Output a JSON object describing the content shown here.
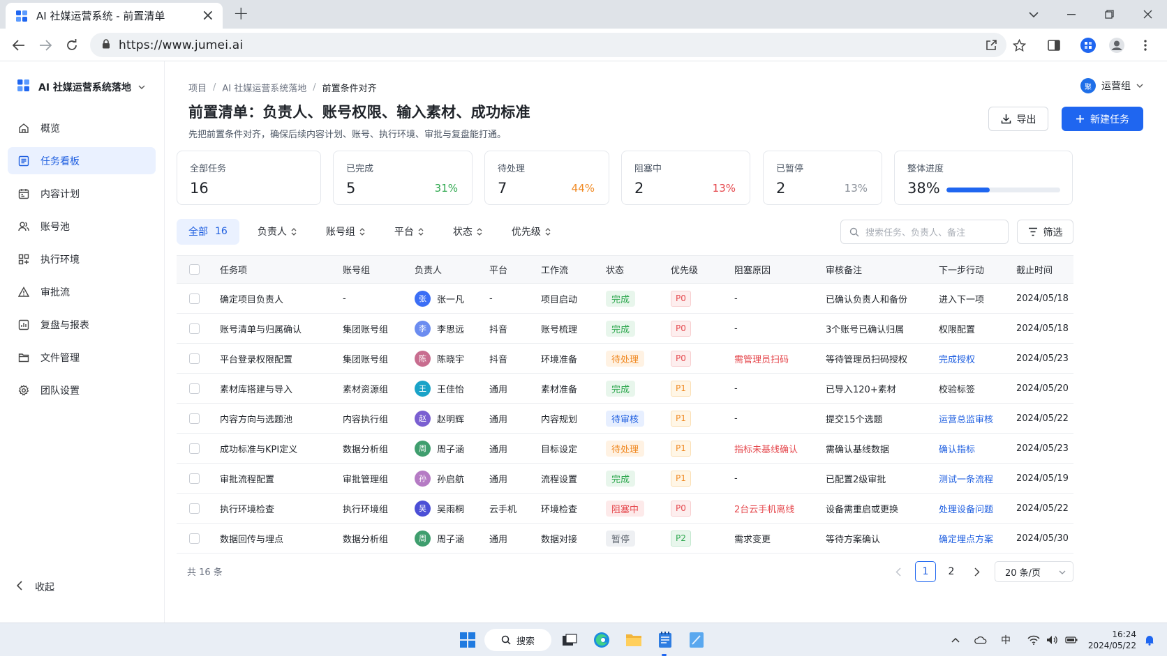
{
  "browser": {
    "tab_title": "AI 社媒运营系统 - 前置清单",
    "url": "https://www.jumei.ai"
  },
  "sidebar": {
    "brand": "AI 社媒运营系统落地",
    "items": [
      {
        "label": "概览",
        "icon": "home-icon"
      },
      {
        "label": "任务看板",
        "icon": "board-icon",
        "active": true
      },
      {
        "label": "内容计划",
        "icon": "calendar-icon"
      },
      {
        "label": "账号池",
        "icon": "users-icon"
      },
      {
        "label": "执行环境",
        "icon": "environment-icon"
      },
      {
        "label": "审批流",
        "icon": "warning-icon"
      },
      {
        "label": "复盘与报表",
        "icon": "chart-icon"
      },
      {
        "label": "文件管理",
        "icon": "folder-icon"
      },
      {
        "label": "团队设置",
        "icon": "gear-icon"
      }
    ],
    "collapse_label": "收起"
  },
  "header": {
    "breadcrumb": [
      "项目",
      "AI 社媒运营系统落地",
      "前置条件对齐"
    ],
    "team_avatar": "聚",
    "team_label": "运营组",
    "title": "前置清单：负责人、账号权限、输入素材、成功标准",
    "subtitle": "先把前置条件对齐，确保后续内容计划、账号、执行环境、审批与复盘能打通。",
    "export_label": "导出",
    "new_task_label": "新建任务"
  },
  "stats": [
    {
      "label": "全部任务",
      "value": "16",
      "pct": ""
    },
    {
      "label": "已完成",
      "value": "5",
      "pct": "31%",
      "color": "#2fa84f"
    },
    {
      "label": "待处理",
      "value": "7",
      "pct": "44%",
      "color": "#f08a24"
    },
    {
      "label": "阻塞中",
      "value": "2",
      "pct": "13%",
      "color": "#e5484d"
    },
    {
      "label": "已暂停",
      "value": "2",
      "pct": "13%",
      "color": "#8a9099"
    },
    {
      "label": "整体进度",
      "value": "38%",
      "progress": 0.38
    }
  ],
  "filters": {
    "all_label": "全部",
    "all_count": "16",
    "dropdowns": [
      "负责人",
      "账号组",
      "平台",
      "状态",
      "优先级"
    ],
    "search_placeholder": "搜索任务、负责人、备注",
    "filter_label": "筛选"
  },
  "table": {
    "columns": [
      "任务项",
      "账号组",
      "负责人",
      "平台",
      "工作流",
      "状态",
      "优先级",
      "阻塞原因",
      "审核备注",
      "下一步行动",
      "截止时间"
    ],
    "rows": [
      {
        "task": "确定项目负责人",
        "group": "-",
        "owner_initial": "张",
        "owner": "张一凡",
        "owner_color": "#3b6ef5",
        "platform": "-",
        "workflow": "项目启动",
        "status": "完成",
        "status_type": "done",
        "priority": "P0",
        "blocker": "-",
        "blocker_red": false,
        "note": "已确认负责人和备份",
        "next": "进入下一项",
        "next_link": false,
        "due": "2024/05/18"
      },
      {
        "task": "账号清单与归属确认",
        "group": "集团账号组",
        "owner_initial": "李",
        "owner": "李思远",
        "owner_color": "#6b8cf0",
        "platform": "抖音",
        "workflow": "账号梳理",
        "status": "完成",
        "status_type": "done",
        "priority": "P0",
        "blocker": "-",
        "blocker_red": false,
        "note": "3个账号已确认归属",
        "next": "权限配置",
        "next_link": false,
        "due": "2024/05/18"
      },
      {
        "task": "平台登录权限配置",
        "group": "集团账号组",
        "owner_initial": "陈",
        "owner": "陈晓宇",
        "owner_color": "#c86d8f",
        "platform": "抖音",
        "workflow": "环境准备",
        "status": "待处理",
        "status_type": "pending",
        "priority": "P0",
        "blocker": "需管理员扫码",
        "blocker_red": true,
        "note": "等待管理员扫码授权",
        "next": "完成授权",
        "next_link": true,
        "due": "2024/05/23"
      },
      {
        "task": "素材库搭建与导入",
        "group": "素材资源组",
        "owner_initial": "王",
        "owner": "王佳怡",
        "owner_color": "#1aa3c8",
        "platform": "通用",
        "workflow": "素材准备",
        "status": "完成",
        "status_type": "done",
        "priority": "P1",
        "blocker": "-",
        "blocker_red": false,
        "note": "已导入120+素材",
        "next": "校验标签",
        "next_link": false,
        "due": "2024/05/20"
      },
      {
        "task": "内容方向与选题池",
        "group": "内容执行组",
        "owner_initial": "赵",
        "owner": "赵明辉",
        "owner_color": "#7a5fd1",
        "platform": "通用",
        "workflow": "内容规划",
        "status": "待审核",
        "status_type": "review",
        "priority": "P1",
        "blocker": "-",
        "blocker_red": false,
        "note": "提交15个选题",
        "next": "运营总监审核",
        "next_link": true,
        "due": "2024/05/22"
      },
      {
        "task": "成功标准与KPI定义",
        "group": "数据分析组",
        "owner_initial": "周",
        "owner": "周子涵",
        "owner_color": "#3f9e6e",
        "platform": "通用",
        "workflow": "目标设定",
        "status": "待处理",
        "status_type": "pending",
        "priority": "P1",
        "blocker": "指标未基线确认",
        "blocker_red": true,
        "note": "需确认基线数据",
        "next": "确认指标",
        "next_link": true,
        "due": "2024/05/23"
      },
      {
        "task": "审批流程配置",
        "group": "审批管理组",
        "owner_initial": "孙",
        "owner": "孙启航",
        "owner_color": "#b57bc4",
        "platform": "通用",
        "workflow": "流程设置",
        "status": "完成",
        "status_type": "done",
        "priority": "P1",
        "blocker": "-",
        "blocker_red": false,
        "note": "已配置2级审批",
        "next": "测试一条流程",
        "next_link": true,
        "due": "2024/05/19"
      },
      {
        "task": "执行环境检查",
        "group": "执行环境组",
        "owner_initial": "吴",
        "owner": "吴雨桐",
        "owner_color": "#4b4fd6",
        "platform": "云手机",
        "workflow": "环境检查",
        "status": "阻塞中",
        "status_type": "blocked",
        "priority": "P0",
        "blocker": "2台云手机离线",
        "blocker_red": true,
        "note": "设备需重启或更换",
        "next": "处理设备问题",
        "next_link": true,
        "due": "2024/05/22"
      },
      {
        "task": "数据回传与埋点",
        "group": "数据分析组",
        "owner_initial": "周",
        "owner": "周子涵",
        "owner_color": "#3f9e6e",
        "platform": "通用",
        "workflow": "数据对接",
        "status": "暂停",
        "status_type": "paused",
        "priority": "P2",
        "blocker": "需求变更",
        "blocker_red": false,
        "note": "等待方案确认",
        "next": "确定埋点方案",
        "next_link": true,
        "due": "2024/05/30"
      }
    ]
  },
  "pagination": {
    "total": "共 16 条",
    "pages": [
      "1",
      "2"
    ],
    "current": "1",
    "page_size": "20 条/页"
  },
  "taskbar": {
    "search_label": "搜索",
    "time": "16:24",
    "date": "2024/05/22",
    "ime": "中"
  },
  "colors": {
    "primary": "#1f66f0",
    "done": "#2fa84f",
    "pending": "#f08a24",
    "blocked": "#e5484d",
    "review": "#1f5fe0",
    "paused": "#5f6670"
  }
}
